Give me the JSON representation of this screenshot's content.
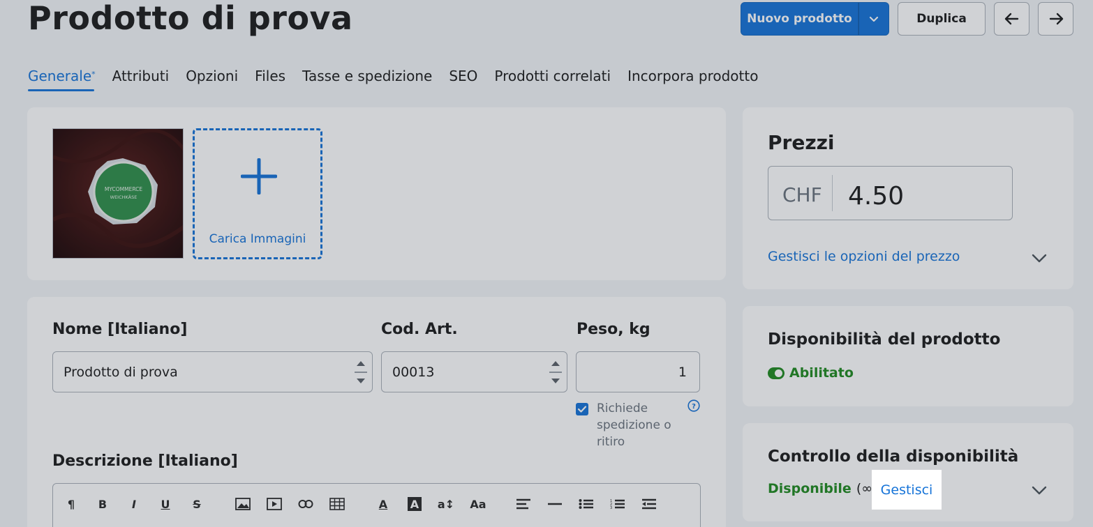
{
  "page": {
    "title": "Prodotto di prova"
  },
  "header": {
    "new_product_label": "Nuovo prodotto",
    "duplicate_label": "Duplica"
  },
  "tabs": [
    {
      "label": "Generale",
      "marker": "*",
      "active": true
    },
    {
      "label": "Attributi"
    },
    {
      "label": "Opzioni"
    },
    {
      "label": "Files"
    },
    {
      "label": "Tasse e spedizione"
    },
    {
      "label": "SEO"
    },
    {
      "label": "Prodotti correlati"
    },
    {
      "label": "Incorpora prodotto"
    }
  ],
  "media": {
    "thumbnail_text_top": "MYCOMMERCE",
    "thumbnail_text_bottom": "WEICHKÄSE",
    "upload_label": "Carica Immagini"
  },
  "form": {
    "name_label": "Nome [Italiano]",
    "name_value": "Prodotto di prova",
    "sku_label": "Cod. Art.",
    "sku_value": "00013",
    "weight_label": "Peso, kg",
    "weight_value": "1",
    "shipping_checkbox_label": "Richiede spedizione o ritiro",
    "shipping_checked": true,
    "description_label": "Descrizione [Italiano]"
  },
  "editor_toolbar": [
    "¶",
    "B",
    "I",
    "U",
    "S",
    "image",
    "video",
    "link",
    "table",
    "A",
    "A",
    "a↕",
    "Aa",
    "align",
    "rule",
    "list",
    "numbered-list",
    "outdent"
  ],
  "pricing": {
    "title": "Prezzi",
    "currency": "CHF",
    "value": "4.50",
    "options_link": "Gestisci le opzioni del prezzo"
  },
  "availability": {
    "title": "Disponibilità del prodotto",
    "status": "Abilitato"
  },
  "stock": {
    "title": "Controllo della disponibilità",
    "status": "Disponibile",
    "quantity": "(∞)",
    "manage_link": "Gestisci"
  },
  "colors": {
    "accent": "#1573d8",
    "success": "#1f8a1f",
    "background": "#f2f5f8"
  }
}
